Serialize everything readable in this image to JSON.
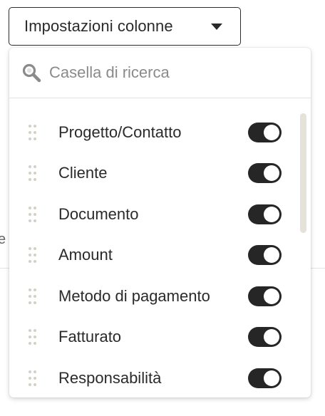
{
  "dropdown": {
    "label": "Impostazioni colonne"
  },
  "search": {
    "placeholder": "Casella di ricerca"
  },
  "background": {
    "edge_text": "e"
  },
  "columns": [
    {
      "label": "Progetto/Contatto",
      "enabled": true
    },
    {
      "label": "Cliente",
      "enabled": true
    },
    {
      "label": "Documento",
      "enabled": true
    },
    {
      "label": "Amount",
      "enabled": true
    },
    {
      "label": "Metodo di pagamento",
      "enabled": true
    },
    {
      "label": "Fatturato",
      "enabled": true
    },
    {
      "label": "Responsabilità",
      "enabled": true
    }
  ],
  "colors": {
    "toggle_on": "#262626",
    "drag_handle": "#d4d0c4",
    "scrollbar": "#e5e2da"
  },
  "icons": {
    "search": "search-icon",
    "caret": "caret-down-icon",
    "drag": "drag-handle-icon"
  }
}
